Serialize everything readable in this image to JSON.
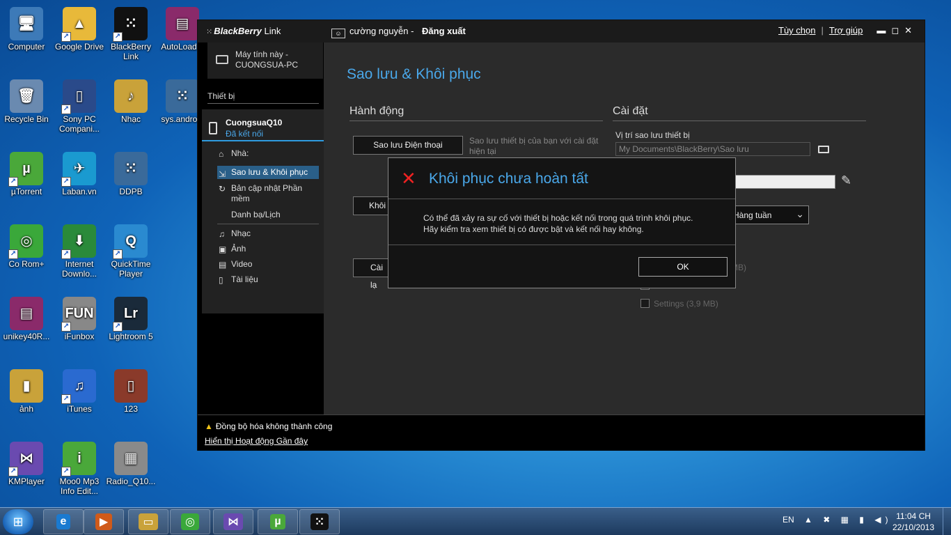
{
  "desktop": {
    "icons": [
      {
        "label": "Computer",
        "glyph": "🖥",
        "color": "#3d7ab8",
        "shortcut": false
      },
      {
        "label": "Google Drive",
        "glyph": "▲",
        "color": "#e8b93a",
        "shortcut": true
      },
      {
        "label": "BlackBerry Link",
        "glyph": "⁙",
        "color": "#111111",
        "shortcut": true
      },
      {
        "label": "AutoLoad...",
        "glyph": "▤",
        "color": "#8a2a6a",
        "shortcut": false
      },
      {
        "label": "Recycle Bin",
        "glyph": "🗑",
        "color": "#6a8ab0",
        "shortcut": false
      },
      {
        "label": "Sony PC Compani...",
        "glyph": "▯",
        "color": "#2a4a8a",
        "shortcut": true
      },
      {
        "label": "Nhạc",
        "glyph": "♪",
        "color": "#c9a23a",
        "shortcut": false
      },
      {
        "label": "sys.android",
        "glyph": "⁙",
        "color": "#3a6a9a",
        "shortcut": false
      },
      {
        "label": "µTorrent",
        "glyph": "µ",
        "color": "#4aa83a",
        "shortcut": true
      },
      {
        "label": "Laban.vn",
        "glyph": "✈",
        "color": "#1a9ad0",
        "shortcut": true
      },
      {
        "label": "DDPB",
        "glyph": "⁙",
        "color": "#3a6a9a",
        "shortcut": false
      },
      {
        "label": "Co Rom+",
        "glyph": "◎",
        "color": "#3aa83a",
        "shortcut": true
      },
      {
        "label": "Internet Downlo...",
        "glyph": "⬇",
        "color": "#2a8a3a",
        "shortcut": true
      },
      {
        "label": "QuickTime Player",
        "glyph": "Q",
        "color": "#2a8ad0",
        "shortcut": true
      },
      {
        "label": "unikey40R...",
        "glyph": "▤",
        "color": "#8a2a6a",
        "shortcut": false
      },
      {
        "label": "iFunbox",
        "glyph": "FUN",
        "color": "#888888",
        "shortcut": true
      },
      {
        "label": "Lightroom 5",
        "glyph": "Lr",
        "color": "#1a2a3a",
        "shortcut": true
      },
      {
        "label": "ảnh",
        "glyph": "▮",
        "color": "#c9a23a",
        "shortcut": false
      },
      {
        "label": "iTunes",
        "glyph": "♫",
        "color": "#2a6ad0",
        "shortcut": true
      },
      {
        "label": "123",
        "glyph": "▯",
        "color": "#8a3a2a",
        "shortcut": false
      },
      {
        "label": "KMPlayer",
        "glyph": "⋈",
        "color": "#6a4ab0",
        "shortcut": true
      },
      {
        "label": "Moo0 Mp3 Info Edit...",
        "glyph": "i",
        "color": "#4aa83a",
        "shortcut": true
      },
      {
        "label": "Radio_Q10...",
        "glyph": "▦",
        "color": "#8a8a8a",
        "shortcut": false
      }
    ]
  },
  "window": {
    "brand_prefix": "BlackBerry",
    "brand_suffix": " Link",
    "user_name": "cường nguyễn",
    "logout": "Đăng xuất",
    "options_link": "Tùy chọn",
    "help_link": "Trợ giúp",
    "controls": "▬◻✕"
  },
  "sidebar": {
    "pc_name_line1": "Máy tính này -",
    "pc_name_line2": "CUONGSUA-PC",
    "devices_label": "Thiết bị",
    "device_name": "CuongsuaQ10",
    "device_status": "Đã kết nối",
    "nav": {
      "home": "Nhà:",
      "backup": "Sao lưu & Khôi phục",
      "update_line1": "Bản cập nhật Phần",
      "update_line2": "mềm",
      "contacts": "Danh bạ/Lịch",
      "music": "Nhạc",
      "photos": "Ảnh",
      "video": "Video",
      "documents": "Tài liệu"
    }
  },
  "main": {
    "title": "Sao lưu & Khôi phục",
    "actions_heading": "Hành động",
    "settings_heading": "Cài đặt",
    "backup_button": "Sao lưu Điện thoại",
    "backup_desc_line1": "Sao lưu thiết bị của bạn với cài đặt",
    "backup_desc_line2": "hiện tại",
    "restore_button_partial": "Khôi",
    "install_button_partial": "Cài lạ",
    "backup_location_label": "Vị trí sao lưu thiết bị",
    "backup_location_value": "My Documents\\BlackBerry\\Sao lưu",
    "frequency_value": "Hàng tuần",
    "size_partial": "MB)",
    "settings_checkbox": "Settings (3,9 MB)"
  },
  "bottom": {
    "sync_warning": "Đồng bộ hóa không thành công",
    "recent_activity_link": "Hiển thị Hoạt động Gần đây"
  },
  "dialog": {
    "title": "Khôi phục chưa hoàn tất",
    "message_line1": "Có thể đã xảy ra sự cố với thiết bị hoặc kết nối trong quá trình khôi phục.",
    "message_line2": "Hãy kiểm tra xem thiết bị có được bật và kết nối hay không.",
    "ok_label": "OK"
  },
  "taskbar": {
    "buttons": [
      "e",
      "▶",
      "▭",
      "◎",
      "⋈",
      "µ",
      "⁙"
    ],
    "language": "EN",
    "tray_icons": "▲ ✖ ▦ ▮ ◀)",
    "time": "11:04 CH",
    "date": "22/10/2013"
  }
}
